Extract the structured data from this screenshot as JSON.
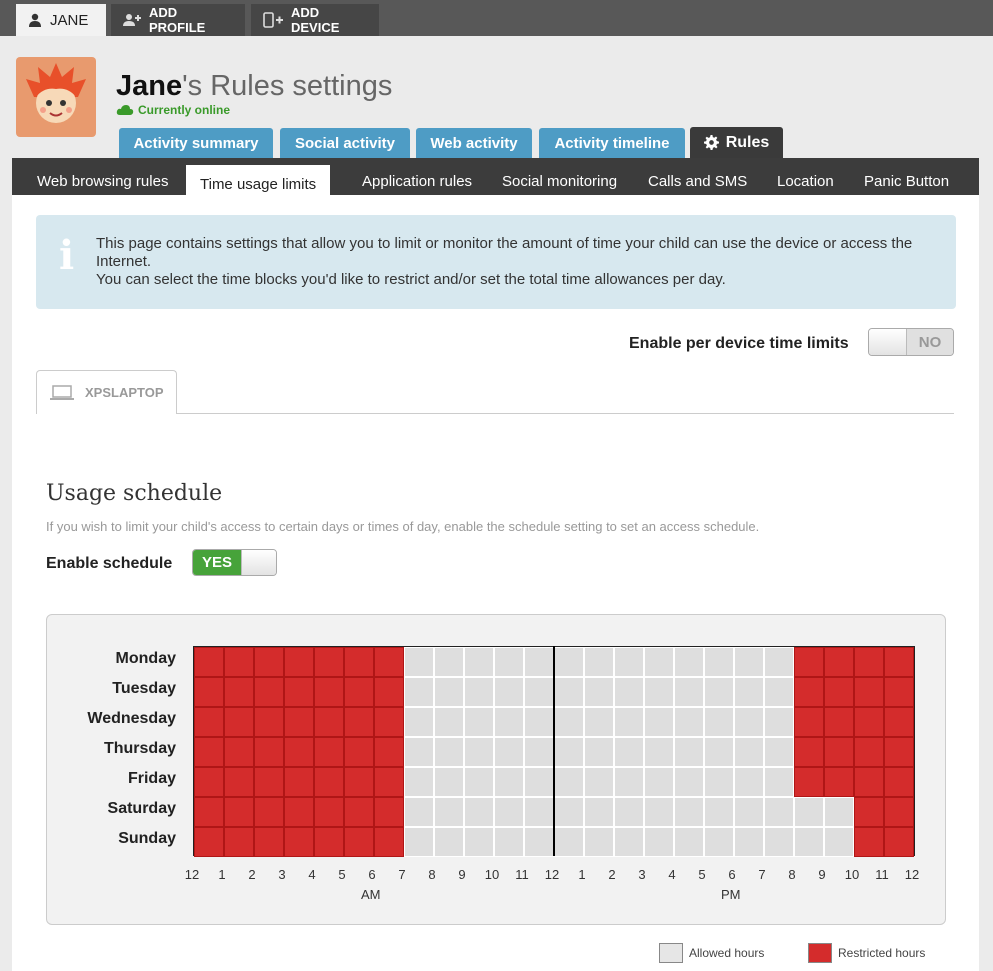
{
  "profile_bar": {
    "active": "JANE",
    "add_profile": "ADD PROFILE",
    "add_device": "ADD DEVICE"
  },
  "header": {
    "name": "Jane",
    "title_suffix": "'s Rules settings",
    "status": "Currently online"
  },
  "main_tabs": [
    "Activity summary",
    "Social activity",
    "Web activity",
    "Activity timeline",
    "Rules"
  ],
  "sub_tabs": [
    "Web browsing rules",
    "Time usage limits",
    "Application rules",
    "Social monitoring",
    "Calls and SMS",
    "Location",
    "Panic Button"
  ],
  "info": {
    "line1": "This page contains settings that allow you to limit or monitor the amount of time your child can use the device or access the Internet.",
    "line2": "You can select the time blocks you'd like to restrict and/or set the total time allowances per day."
  },
  "device_limits": {
    "label": "Enable per device time limits",
    "state": "NO"
  },
  "device_tab": "XPSLAPTOP",
  "schedule": {
    "title": "Usage schedule",
    "description": "If you wish to limit your child's access to certain days or times of day, enable the schedule setting to set an access schedule.",
    "enable_label": "Enable schedule",
    "enable_state": "YES",
    "days": [
      "Monday",
      "Tuesday",
      "Wednesday",
      "Thursday",
      "Friday",
      "Saturday",
      "Sunday"
    ],
    "hour_labels": [
      "12",
      "1",
      "2",
      "3",
      "4",
      "5",
      "6",
      "7",
      "8",
      "9",
      "10",
      "11",
      "12",
      "1",
      "2",
      "3",
      "4",
      "5",
      "6",
      "7",
      "8",
      "9",
      "10",
      "11",
      "12"
    ],
    "am_label": "AM",
    "pm_label": "PM",
    "restricted": [
      [
        0,
        1,
        2,
        3,
        4,
        5,
        6,
        20,
        21,
        22,
        23
      ],
      [
        0,
        1,
        2,
        3,
        4,
        5,
        6,
        20,
        21,
        22,
        23
      ],
      [
        0,
        1,
        2,
        3,
        4,
        5,
        6,
        20,
        21,
        22,
        23
      ],
      [
        0,
        1,
        2,
        3,
        4,
        5,
        6,
        20,
        21,
        22,
        23
      ],
      [
        0,
        1,
        2,
        3,
        4,
        5,
        6,
        20,
        21,
        22,
        23
      ],
      [
        0,
        1,
        2,
        3,
        4,
        5,
        6,
        22,
        23
      ],
      [
        0,
        1,
        2,
        3,
        4,
        5,
        6,
        22,
        23
      ]
    ]
  },
  "legend": {
    "allowed": "Allowed hours",
    "restricted": "Restricted hours"
  },
  "colors": {
    "restricted": "#d42c2c",
    "allowed": "#dedede",
    "tab_blue": "#4e9cc5",
    "online_green": "#3a9a2a"
  }
}
